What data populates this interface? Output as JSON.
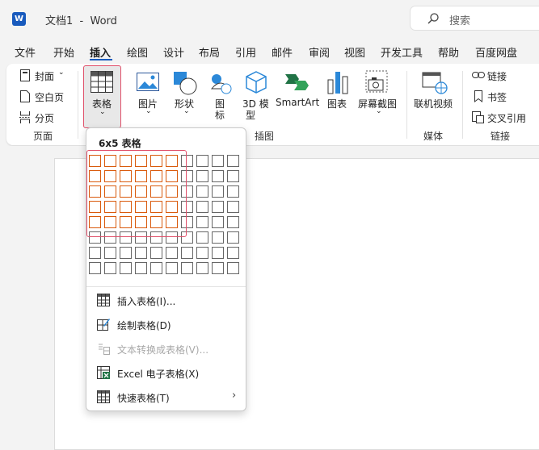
{
  "titlebar": {
    "doc_title": "文档1  -  Word",
    "app_icon_letter": "W",
    "search_placeholder": "搜索"
  },
  "menu": {
    "items": [
      "文件",
      "开始",
      "插入",
      "绘图",
      "设计",
      "布局",
      "引用",
      "邮件",
      "审阅",
      "视图",
      "开发工具",
      "帮助",
      "百度网盘"
    ],
    "active": "插入"
  },
  "ribbon": {
    "pages_group": {
      "cover": "封面",
      "blank_page": "空白页",
      "page_break": "分页",
      "label": "页面"
    },
    "table_button": "表格",
    "illustrations": {
      "picture": "图片",
      "shapes": "形状",
      "icons_line1": "图",
      "icons_line2": "标",
      "model3d_line1": "3D 模",
      "model3d_line2": "型",
      "smartart": "SmartArt",
      "chart": "图表",
      "screenshot": "屏幕截图",
      "label": "插图"
    },
    "media": {
      "online_video": "联机视频",
      "label": "媒体"
    },
    "links": {
      "link": "链接",
      "bookmark": "书签",
      "cross_ref": "交叉引用",
      "label": "链接"
    }
  },
  "table_dropdown": {
    "title": "6x5 表格",
    "grid_cols": 10,
    "grid_rows": 8,
    "selected_cols": 6,
    "selected_rows": 5,
    "items": [
      {
        "label": "插入表格(I)...",
        "icon": "grid-icon",
        "enabled": true
      },
      {
        "label": "绘制表格(D)",
        "icon": "pencil-table-icon",
        "enabled": true
      },
      {
        "label": "文本转换成表格(V)...",
        "icon": "convert-text-icon",
        "enabled": false
      },
      {
        "label": "Excel 电子表格(X)",
        "icon": "excel-icon",
        "enabled": true
      },
      {
        "label": "快速表格(T)",
        "icon": "quick-table-icon",
        "enabled": true,
        "submenu": true
      }
    ]
  },
  "colors": {
    "word_blue": "#185abd",
    "selected_cell": "#d95a0c",
    "highlight": "#e0506a"
  }
}
